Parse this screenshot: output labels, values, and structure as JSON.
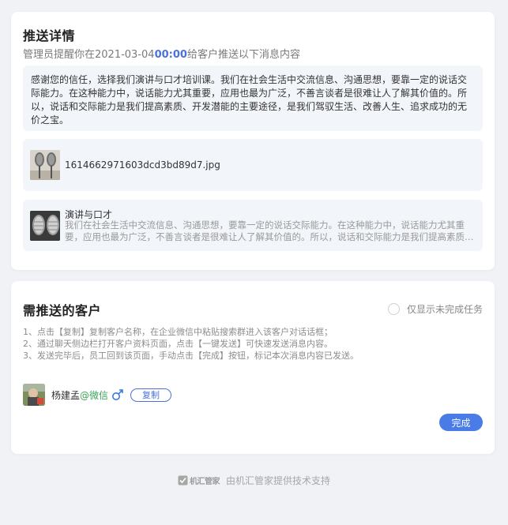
{
  "push_detail": {
    "title": "推送详情",
    "subtitle_prefix": "管理员提醒你在2021-03-04",
    "subtitle_time": "00:00",
    "subtitle_suffix": "给客户推送以下消息内容",
    "text_message": "感谢您的信任，选择我们演讲与口才培训课。我们在社会生活中交流信息、沟通思想，要靠一定的说话交际能力。在这种能力中，说话能力尤其重要，应用也最为广泛，不善言谈者是很难让人了解其价值的。所以，说话和交际能力是我们提高素质、开发潜能的主要途径，是我们驾驭生活、改善人生、追求成功的无价之宝。",
    "image_message": {
      "file_name": "1614662971603dcd3bd89d7.jpg"
    },
    "link_message": {
      "title": "演讲与口才",
      "description": "我们在社会生活中交流信息、沟通思想，要靠一定的说话交际能力。在这种能力中，说话能力尤其重要，应用也最为广泛，不善言谈者是很难让人了解其价值的。所以，说话和交际能力是我们提高素质、开发潜能的主要途径，是我们驾驭生活、改善人生、追求成功的无价之宝。"
    }
  },
  "customers": {
    "title": "需推送的客户",
    "filter_label": "仅显示未完成任务",
    "instructions": [
      "1、点击【复制】复制客户名称，在企业微信中粘贴搜索群进入该客户对话话框；",
      "2、通过聊天侧边栏打开客户资料页面，点击【一键发送】可快速发送消息内容。",
      "3、发送完毕后，员工回到该页面，手动点击【完成】按钮，标记本次消息内容已发送。"
    ],
    "list": [
      {
        "name": "杨建孟",
        "source": "@微信",
        "gender_icon": "male-icon",
        "copy_label": "复制"
      }
    ],
    "done_label": "完成"
  },
  "footer": {
    "brand_name": "机汇管家",
    "text": "由机汇管家提供技术支持"
  },
  "colors": {
    "accent": "#4a72d9",
    "done_button": "#4a7ce8",
    "wechat_green": "#3aa35a",
    "page_bg": "#f0f2f5",
    "message_bg": "#f2f5fa"
  }
}
